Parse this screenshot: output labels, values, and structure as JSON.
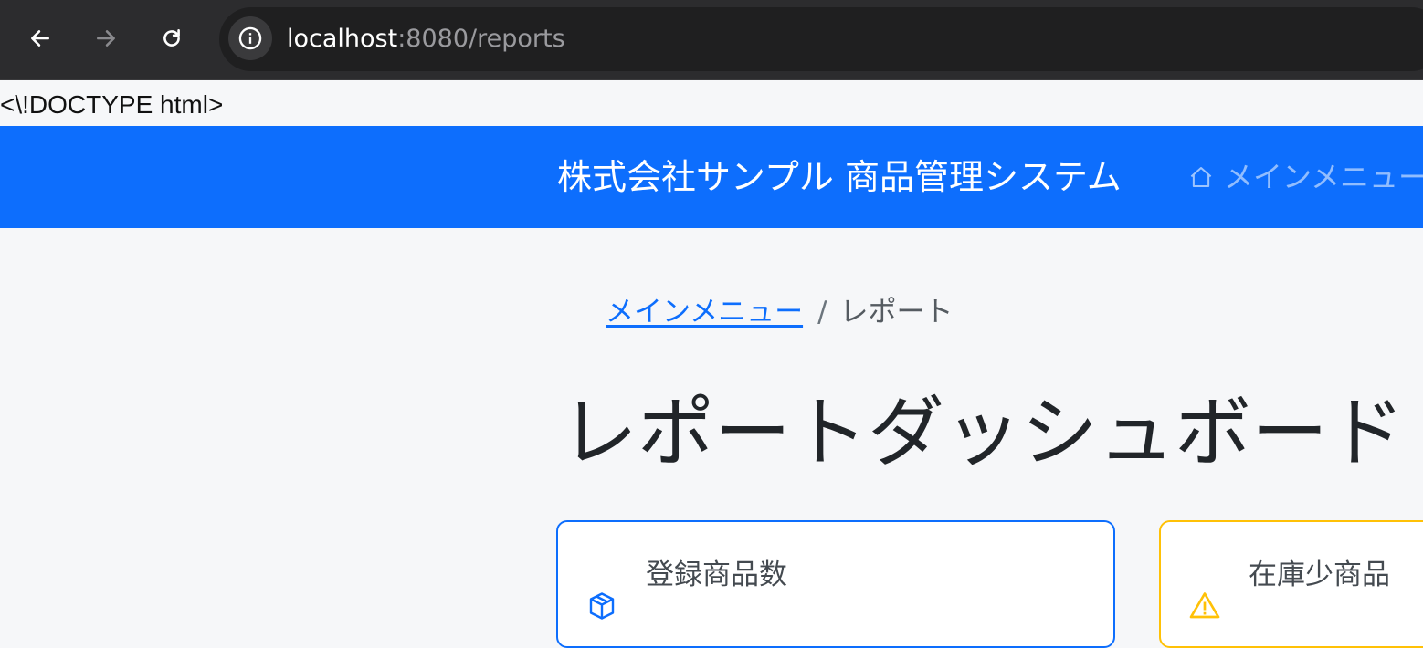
{
  "browser": {
    "url_host": "localhost",
    "url_path": ":8080/reports"
  },
  "stray_text": "<\\!DOCTYPE html>",
  "header": {
    "brand": "株式会社サンプル 商品管理システム",
    "main_menu_label": "メインメニュー"
  },
  "breadcrumb": {
    "home_label": "メインメニュー",
    "separator": "/",
    "current_label": "レポート"
  },
  "page": {
    "title": "レポートダッシュボード"
  },
  "cards": {
    "products_label": "登録商品数",
    "low_stock_label": "在庫少商品"
  },
  "colors": {
    "primary": "#0d6efd",
    "warning": "#ffc107"
  }
}
